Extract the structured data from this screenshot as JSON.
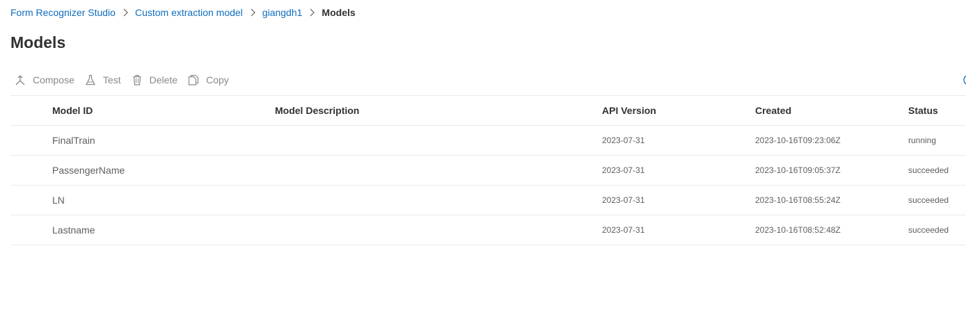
{
  "breadcrumb": {
    "items": [
      {
        "label": "Form Recognizer Studio"
      },
      {
        "label": "Custom extraction model"
      },
      {
        "label": "giangdh1"
      }
    ],
    "current": "Models"
  },
  "page": {
    "title": "Models"
  },
  "toolbar": {
    "compose": "Compose",
    "test": "Test",
    "delete": "Delete",
    "copy": "Copy"
  },
  "table": {
    "columns": {
      "model_id": "Model ID",
      "description": "Model Description",
      "api_version": "API Version",
      "created": "Created",
      "status": "Status"
    },
    "rows": [
      {
        "model_id": "FinalTrain",
        "description": "",
        "api_version": "2023-07-31",
        "created": "2023-10-16T09:23:06Z",
        "status": "running"
      },
      {
        "model_id": "PassengerName",
        "description": "",
        "api_version": "2023-07-31",
        "created": "2023-10-16T09:05:37Z",
        "status": "succeeded"
      },
      {
        "model_id": "LN",
        "description": "",
        "api_version": "2023-07-31",
        "created": "2023-10-16T08:55:24Z",
        "status": "succeeded"
      },
      {
        "model_id": "Lastname",
        "description": "",
        "api_version": "2023-07-31",
        "created": "2023-10-16T08:52:48Z",
        "status": "succeeded"
      }
    ]
  },
  "colors": {
    "link": "#0f6cbd",
    "text": "#323130",
    "muted": "#8a8886",
    "divider": "#edebe9"
  }
}
